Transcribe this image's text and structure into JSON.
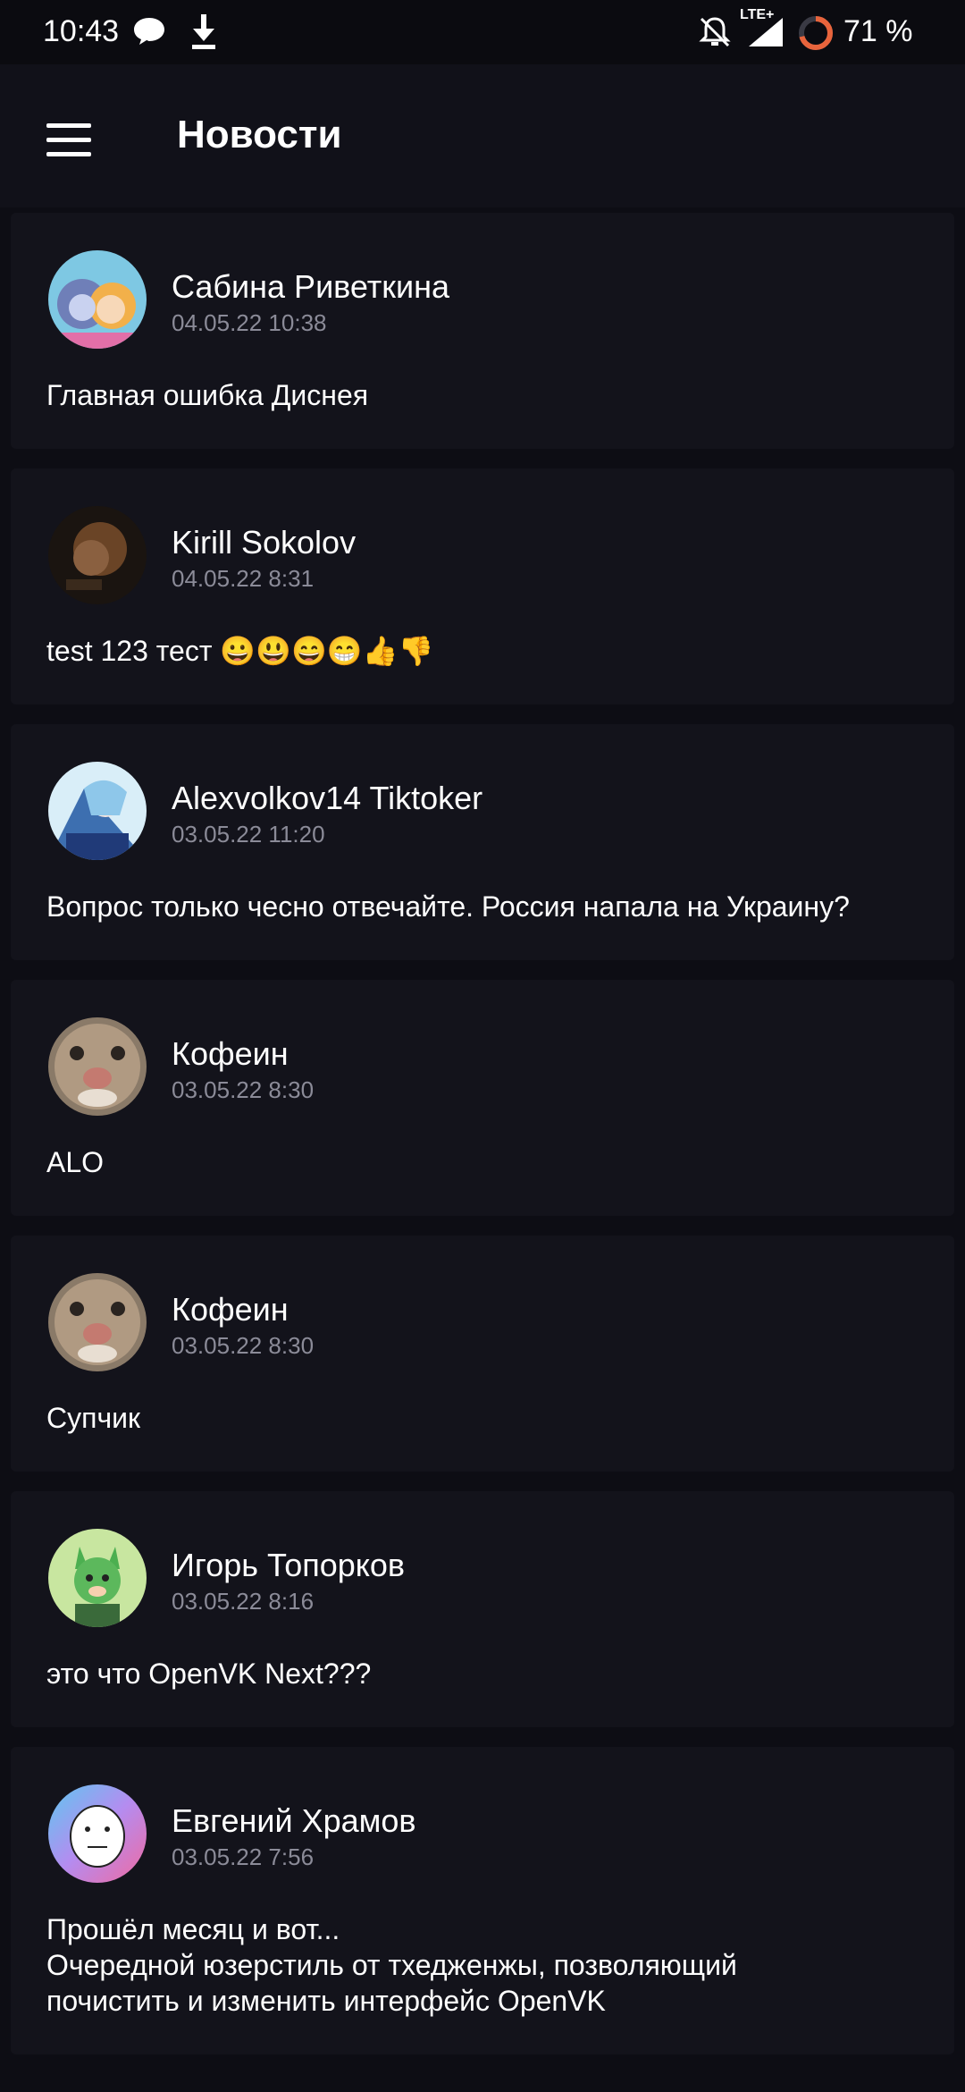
{
  "status_bar": {
    "time": "10:43",
    "network": "LTE+",
    "battery": "71 %",
    "icons": [
      "message-icon",
      "download-icon",
      "mute-icon",
      "signal-icon",
      "battery-ring-icon"
    ]
  },
  "app_bar": {
    "title": "Новости",
    "menu_icon": "hamburger-menu-icon"
  },
  "posts": [
    {
      "author": "Сабина Риветкина",
      "date": "04.05.22 10:38",
      "lines": [
        "Главная ошибка Диснея"
      ]
    },
    {
      "author": "Kirill Sokolov",
      "date": "04.05.22 8:31",
      "lines": [
        "test 123 тест 😀😃😄😁👍👎"
      ]
    },
    {
      "author": "Alexvolkov14 Tiktoker",
      "date": "03.05.22 11:20",
      "lines": [
        "Вопрос только чесно отвечайте. Россия напала на Украину?"
      ]
    },
    {
      "author": "Кофеин",
      "date": "03.05.22 8:30",
      "lines": [
        "ALO"
      ]
    },
    {
      "author": "Кофеин",
      "date": "03.05.22 8:30",
      "lines": [
        "Супчик"
      ]
    },
    {
      "author": "Игорь Топорков",
      "date": "03.05.22 8:16",
      "lines": [
        "это что OpenVK Next???"
      ]
    },
    {
      "author": "Евгений Храмов",
      "date": "03.05.22 7:56",
      "lines": [
        "Прошёл месяц и вот...",
        "Очередной юзерстиль от тхедженжы, позволяющий",
        "почистить и изменить интерфейс OpenVK"
      ]
    }
  ],
  "colors": {
    "background": "#0d0d14",
    "card": "#13131b",
    "secondary_text": "#8b8b98",
    "battery_ring": "#e8643c"
  }
}
